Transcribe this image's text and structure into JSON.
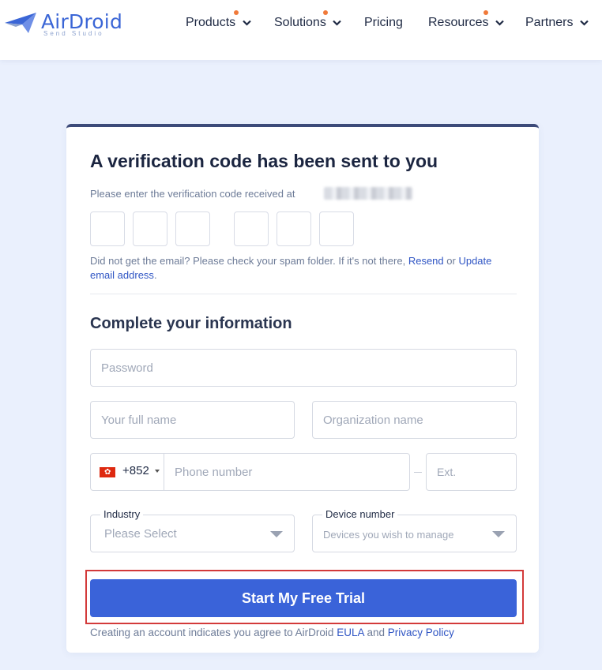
{
  "brand": {
    "name": "AirDroid",
    "sub": "Send Studio"
  },
  "nav": [
    {
      "label": "Products",
      "dot": true
    },
    {
      "label": "Solutions",
      "dot": true
    },
    {
      "label": "Pricing",
      "dot": false
    },
    {
      "label": "Resources",
      "dot": true
    },
    {
      "label": "Partners",
      "dot": false
    }
  ],
  "verify": {
    "title": "A verification code has been sent to you",
    "subtitle": "Please enter the verification code received at",
    "note_prefix": "Did not get the email? Please check your spam folder. If it's not there,",
    "resend": "Resend",
    "or": "or",
    "update": "Update email address",
    "period": "."
  },
  "info": {
    "title": "Complete your information",
    "password_placeholder": "Password",
    "fullname_placeholder": "Your full name",
    "org_placeholder": "Organization name",
    "dial_code": "+852",
    "phone_placeholder": "Phone number",
    "ext_placeholder": "Ext.",
    "industry_label": "Industry",
    "industry_value": "Please Select",
    "device_label": "Device number",
    "device_value": "Devices you wish to manage"
  },
  "cta": {
    "label": "Start My Free Trial"
  },
  "legal": {
    "prefix": "Creating an account indicates you agree to AirDroid",
    "eula": "EULA",
    "and": "and",
    "privacy": "Privacy Policy"
  },
  "colors": {
    "accent": "#3a63d9",
    "highlight": "#d33a3a",
    "nav_dot": "#f07a3a"
  }
}
